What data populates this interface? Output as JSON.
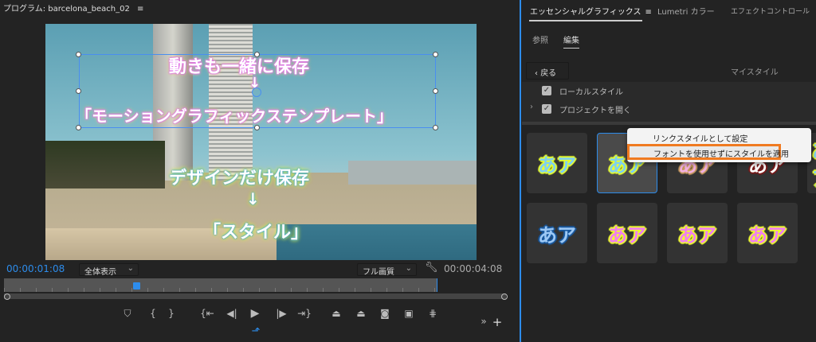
{
  "program": {
    "title": "プログラム: barcelona_beach_02",
    "menu_icon": "hamburger-icon"
  },
  "overlay": {
    "line1": "動きも一緒に保存",
    "arrow1": "↓",
    "line2": "「モーショングラフィックステンプレート」",
    "line3": "デザインだけ保存",
    "arrow2": "↓",
    "line4": "「スタイル」"
  },
  "playback": {
    "current_time": "00:00:01:08",
    "zoom": "全体表示",
    "quality": "フル画質",
    "duration": "00:00:04:08",
    "progress": 0.28
  },
  "controls": [
    "marker",
    "mark-in",
    "mark-out",
    "go-to-in",
    "step-back",
    "play",
    "step-forward",
    "go-to-out",
    "lift",
    "extract",
    "export-frame",
    "compare",
    "trim"
  ],
  "tabs": {
    "essential": "エッセンシャルグラフィックス",
    "lumetri": "Lumetri カラー",
    "effect": "エフェクトコントロール"
  },
  "subtabs": {
    "browse": "参照",
    "edit": "編集"
  },
  "back": "戻る",
  "my_styles": "マイスタイル",
  "tree": {
    "local": "ローカルスタイル",
    "project": "プロジェクトを開く"
  },
  "tile_text": "あア",
  "styles": [
    {
      "fill": "#7fd0f0",
      "stroke": "#e8ff30"
    },
    {
      "fill": "#7fd0f0",
      "stroke": "#e8ff30",
      "selected": true
    },
    {
      "fill": "#f2b0e0",
      "stroke": "#c89a60"
    },
    {
      "fill": "#ffffff",
      "stroke": "#7a1a1a"
    },
    {
      "fill": "#7fd0f0",
      "stroke": "#e8ff30"
    },
    {
      "fill": "#9cc8f5",
      "stroke": "#1a5aa0"
    },
    {
      "fill": "#f07ef0",
      "stroke": "#f0ff30"
    },
    {
      "fill": "#f07ef0",
      "stroke": "#f0ff30"
    },
    {
      "fill": "#f07ef0",
      "stroke": "#f0ff30"
    }
  ],
  "context_menu": {
    "items": [
      "リンクスタイルとして設定",
      "フォントを使用せずにスタイルを適用"
    ],
    "highlight_color": "#f07a20"
  },
  "accent": "#2d8ceb"
}
